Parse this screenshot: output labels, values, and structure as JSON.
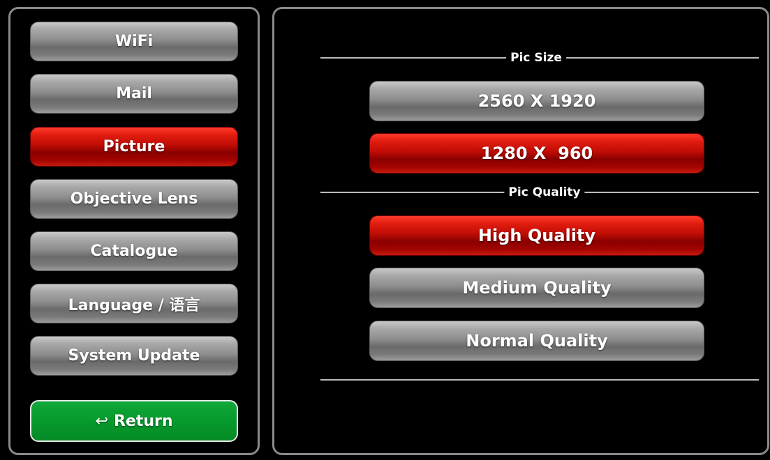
{
  "sidebar": {
    "items": [
      {
        "label": "WiFi",
        "active": false
      },
      {
        "label": "Mail",
        "active": false
      },
      {
        "label": "Picture",
        "active": true
      },
      {
        "label": "Objective Lens",
        "active": false
      },
      {
        "label": "Catalogue",
        "active": false
      },
      {
        "label": "Language / 语言",
        "active": false
      },
      {
        "label": "System Update",
        "active": false
      }
    ],
    "return_label": "Return",
    "return_icon": "↩"
  },
  "main": {
    "pic_size": {
      "label": "Pic Size",
      "options": [
        {
          "label": "2560 X 1920",
          "selected": false
        },
        {
          "label": "1280 X  960",
          "selected": true
        }
      ]
    },
    "pic_quality": {
      "label": "Pic Quality",
      "options": [
        {
          "label": "High Quality",
          "selected": true
        },
        {
          "label": "Medium Quality",
          "selected": false
        },
        {
          "label": "Normal Quality",
          "selected": false
        }
      ]
    }
  },
  "colors": {
    "active": "#c00d05",
    "inactive": "#8e8e8e",
    "return": "#069a2c",
    "background": "#000000"
  }
}
